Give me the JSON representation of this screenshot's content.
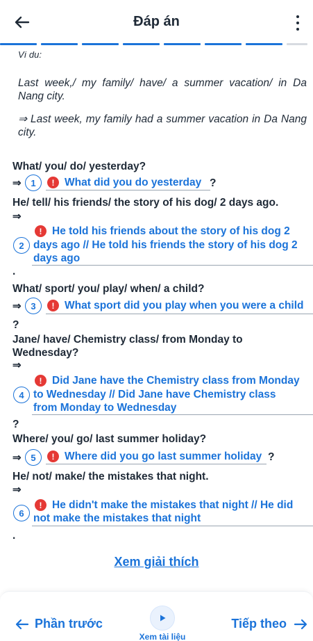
{
  "header": {
    "title": "Đáp án",
    "progress_total": 8,
    "progress_done": 7
  },
  "example": {
    "cut_label": "Ví dụ:",
    "prompt": "Last week,/ my family/ have/ a summer vacation/ in Da Nang city.",
    "answer": "⇒ Last week, my family had a summer vacation in Da Nang city."
  },
  "items": [
    {
      "number": "1",
      "question": "What/ you/ do/ yesterday?",
      "arrow": "⇒",
      "answer": "What did you do yesterday",
      "suffix": "?"
    },
    {
      "number": "2",
      "question": "He/ tell/ his friends/ the story of his dog/ 2 days ago.",
      "arrow": "⇒",
      "answer_line1": "He told his friends about the story of his dog 2",
      "answer_line2": "days ago // He told his friends the story of his dog 2",
      "answer_line3": "days ago",
      "suffix": "."
    },
    {
      "number": "3",
      "question": "What/ sport/ you/ play/ when/ a child?",
      "arrow": "⇒",
      "answer": "What sport did you play when you were a child",
      "suffix": "?"
    },
    {
      "number": "4",
      "question_line1": "Jane/ have/ Chemistry class/ from Monday to",
      "question_line2": "Wednesday?",
      "arrow": "⇒",
      "answer_line1": "Did Jane have the Chemistry class from Monday",
      "answer_line2": "to Wednesday // Did Jane have Chemistry class",
      "answer_line3": "from Monday to Wednesday",
      "suffix": "?"
    },
    {
      "number": "5",
      "question": "Where/ you/ go/ last summer holiday?",
      "arrow": "⇒",
      "answer": "Where did you go last summer holiday",
      "suffix": "?"
    },
    {
      "number": "6",
      "question": "He/ not/ make/ the mistakes that night.",
      "arrow": "⇒",
      "answer_line1": "He didn't make the mistakes that night // He did",
      "answer_line2": "not make the mistakes that night",
      "suffix": "."
    }
  ],
  "explain_link": "Xem giải thích",
  "footer": {
    "prev_label": "Phần trước",
    "next_label": "Tiếp theo",
    "docs_label": "Xem tài liệu"
  },
  "colors": {
    "accent": "#1b73d9",
    "error": "#e53935",
    "text": "#1f2a37"
  }
}
